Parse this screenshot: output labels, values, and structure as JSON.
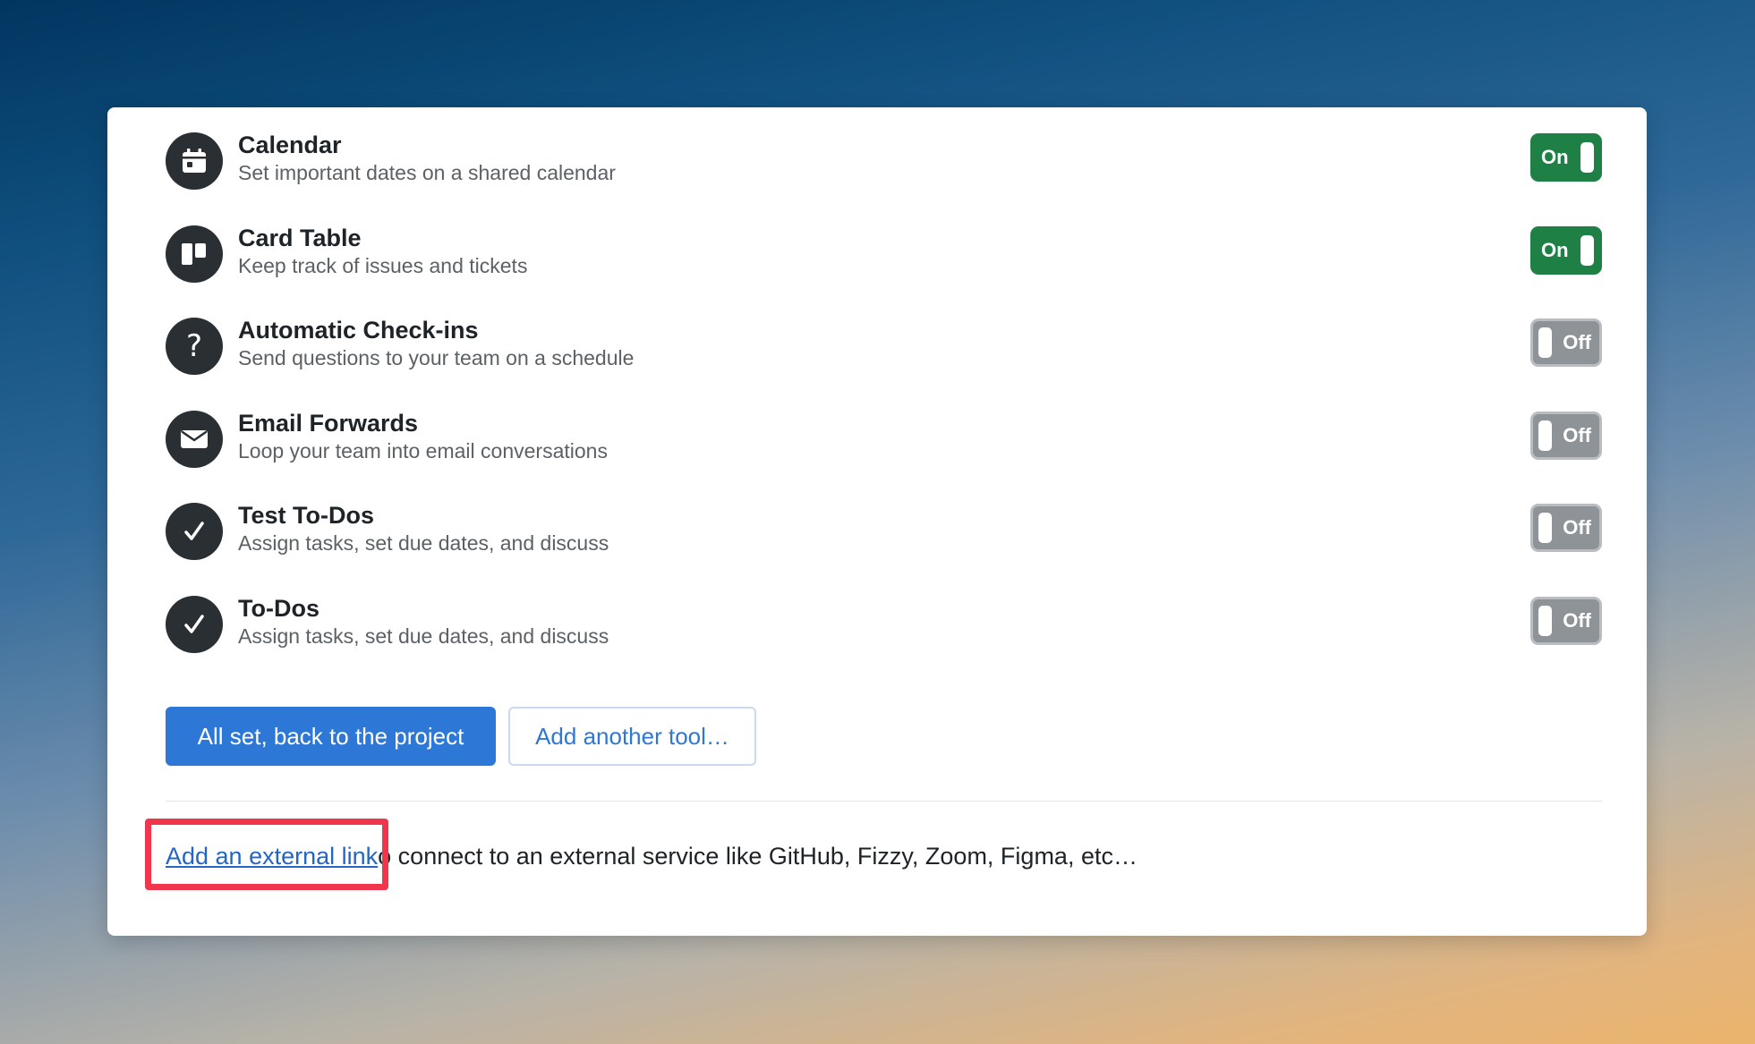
{
  "tools": [
    {
      "name": "Calendar",
      "description": "Set important dates on a shared calendar",
      "icon": "calendar-icon",
      "state": "on",
      "toggle_label": "On"
    },
    {
      "name": "Card Table",
      "description": "Keep track of issues and tickets",
      "icon": "card-table-icon",
      "state": "on",
      "toggle_label": "On"
    },
    {
      "name": "Automatic Check-ins",
      "description": "Send questions to your team on a schedule",
      "icon": "question-icon",
      "state": "off",
      "toggle_label": "Off"
    },
    {
      "name": "Email Forwards",
      "description": "Loop your team into email conversations",
      "icon": "envelope-icon",
      "state": "off",
      "toggle_label": "Off"
    },
    {
      "name": "Test To-Dos",
      "description": "Assign tasks, set due dates, and discuss",
      "icon": "checkmark-icon",
      "state": "off",
      "toggle_label": "Off"
    },
    {
      "name": "To-Dos",
      "description": "Assign tasks, set due dates, and discuss",
      "icon": "checkmark-icon",
      "state": "off",
      "toggle_label": "Off"
    }
  ],
  "actions": {
    "primary_label": "All set, back to the project",
    "secondary_label": "Add another tool…"
  },
  "footer": {
    "link_label": "Add an external link",
    "text": "o connect to an external service like GitHub, Fizzy, Zoom, Figma, etc…"
  },
  "colors": {
    "toggle_on": "#1f8046",
    "toggle_off": "#8e9398",
    "primary": "#2d78d6",
    "link": "#2566c2",
    "highlight": "#f0364c",
    "icon_bg": "#2a2f33"
  }
}
